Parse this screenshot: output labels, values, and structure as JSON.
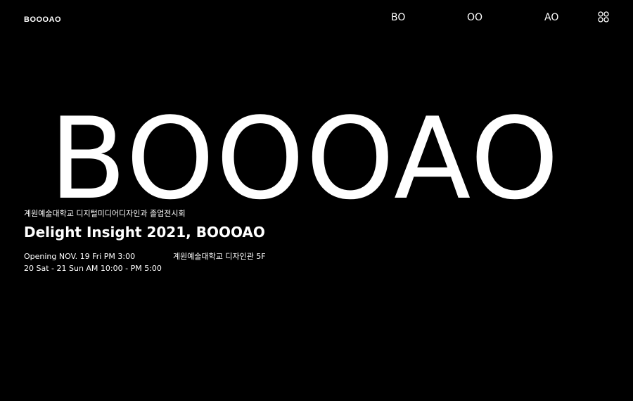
{
  "header": {
    "logo": "BOOOAO",
    "nav": [
      {
        "label": "BO"
      },
      {
        "label": "OO"
      },
      {
        "label": "AO"
      }
    ],
    "menu_icon": "four-circles-grid-icon"
  },
  "hero": {
    "title": "BOOOAO"
  },
  "exhibition": {
    "subtitle": "계원예술대학교 디지털미디어디자인과 졸업전시회",
    "title": "Delight Insight 2021, BOOOAO",
    "opening": "Opening NOV. 19 Fri PM 3:00",
    "schedule": "20 Sat - 21 Sun AM 10:00 - PM 5:00",
    "location": "계원예술대학교 디자인관 5F"
  },
  "colors": {
    "background": "#000000",
    "text": "#ffffff"
  }
}
